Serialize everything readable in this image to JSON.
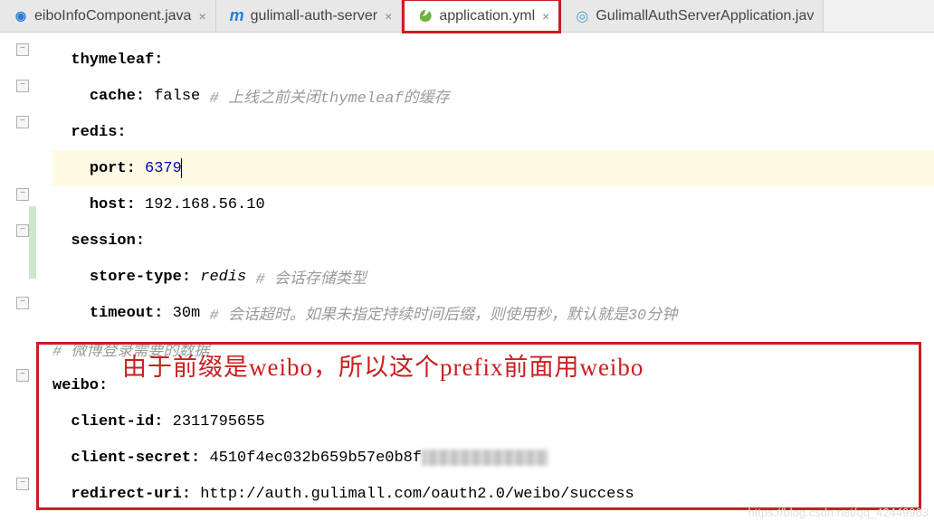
{
  "tabs": [
    {
      "label": "eiboInfoComponent.java",
      "icon": "c"
    },
    {
      "label": "gulimall-auth-server",
      "icon": "m"
    },
    {
      "label": "application.yml",
      "icon": "leaf",
      "active": true
    },
    {
      "label": "GulimallAuthServerApplication.jav",
      "icon": "sb"
    }
  ],
  "code": {
    "thymeleaf_key": "thymeleaf",
    "cache_key": "cache",
    "cache_val": "false",
    "cache_comment": "# 上线之前关闭thymeleaf的缓存",
    "redis_key": "redis",
    "port_key": "port",
    "port_val": "6379",
    "host_key": "host",
    "host_val": "192.168.56.10",
    "session_key": "session",
    "storetype_key": "store-type",
    "storetype_val": "redis",
    "storetype_comment": "# 会话存储类型",
    "timeout_key": "timeout",
    "timeout_val": "30m",
    "timeout_comment": "# 会话超时。如果未指定持续时间后缀，则使用秒，默认就是30分钟",
    "weibo_comment": "# 微博登录需要的数据",
    "weibo_key": "weibo",
    "clientid_key": "client-id",
    "clientid_val": "2311795655",
    "clientsecret_key": "client-secret",
    "clientsecret_val": "4510f4ec032b659b57e0b8f",
    "redirecturi_key": "redirect-uri",
    "redirecturi_val": "http://auth.gulimall.com/oauth2.0/weibo/success"
  },
  "annotation": "由于前缀是weibo，所以这个prefix前面用weibo",
  "watermark": "https://blog.csdn.net/qq_42449963"
}
